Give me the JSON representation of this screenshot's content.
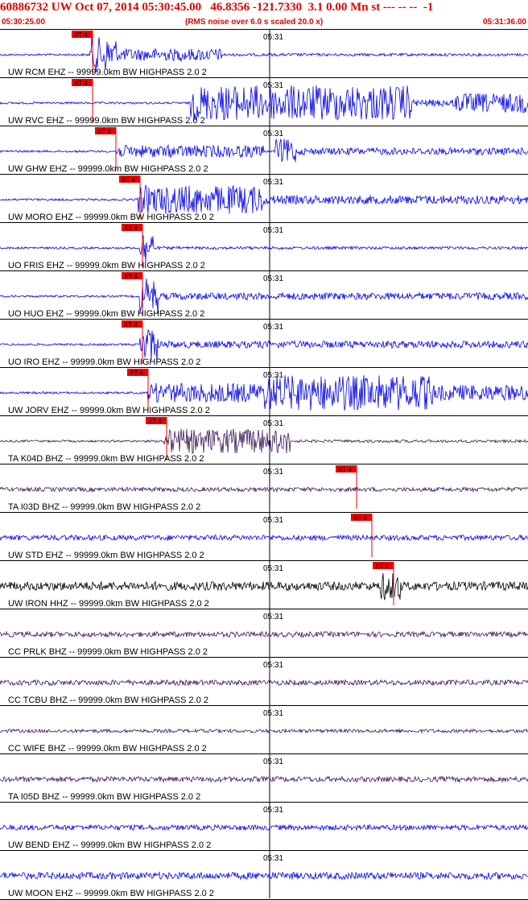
{
  "header": {
    "title": "60886732 UW Oct 07, 2014 05:30:45.00   46.8356 -121.7330  3.1 0.00 Mn st --- -- --  -1",
    "start_time": "05:30:25.00",
    "note": "(RMS noise over 6.0 s scaled 20.0 x)",
    "end_time": "05:31:36.00"
  },
  "minute_label": "05:31",
  "pick_label": "XT 4",
  "colors": {
    "blue": "#0000ee",
    "purple": "#3a1a5a",
    "black": "#000000",
    "pick": "#ee0000",
    "grid": "#000000"
  },
  "traces": [
    {
      "label": "UW RCM EHZ -- 99999.0km BW  HIGHPASS  2.0  2",
      "color": "blue",
      "pick": 0.175,
      "amp": [
        [
          0.17,
          0.22,
          1.0
        ],
        [
          0.22,
          0.42,
          0.35
        ],
        [
          0.42,
          1.0,
          0.08
        ]
      ]
    },
    {
      "label": "UW RVC EHZ -- 99999.0km BW  HIGHPASS  2.0  2",
      "color": "blue",
      "pick": 0.175,
      "amp": [
        [
          0.36,
          0.78,
          1.0
        ],
        [
          0.78,
          0.86,
          0.2
        ],
        [
          0.86,
          1.0,
          0.55
        ]
      ]
    },
    {
      "label": "UW GHW EHZ -- 99999.0km BW  HIGHPASS  2.0  2",
      "color": "blue",
      "pick": 0.22,
      "amp": [
        [
          0.22,
          0.5,
          0.35
        ],
        [
          0.52,
          0.56,
          0.7
        ],
        [
          0.56,
          1.0,
          0.2
        ]
      ]
    },
    {
      "label": "UW MORO EHZ -- 99999.0km BW  HIGHPASS  2.0  2",
      "color": "blue",
      "pick": 0.265,
      "amp": [
        [
          0.26,
          0.5,
          0.8
        ],
        [
          0.5,
          1.0,
          0.25
        ]
      ]
    },
    {
      "label": "UO FRIS EHZ -- 99999.0km BW  HIGHPASS  2.0  2",
      "color": "blue",
      "pick": 0.27,
      "amp": [
        [
          0.265,
          0.29,
          1.0
        ],
        [
          0.29,
          1.0,
          0.08
        ]
      ]
    },
    {
      "label": "UO HUO EHZ -- 99999.0km BW  HIGHPASS  2.0  2",
      "color": "blue",
      "pick": 0.27,
      "amp": [
        [
          0.265,
          0.3,
          1.0
        ],
        [
          0.3,
          1.0,
          0.2
        ]
      ]
    },
    {
      "label": "UO IRO EHZ -- 99999.0km BW  HIGHPASS  2.0  2",
      "color": "blue",
      "pick": 0.27,
      "amp": [
        [
          0.265,
          0.3,
          1.0
        ],
        [
          0.3,
          1.0,
          0.2
        ]
      ]
    },
    {
      "label": "UW JORV EHZ -- 99999.0km BW  HIGHPASS  2.0  2",
      "color": "blue",
      "pick": 0.28,
      "amp": [
        [
          0.28,
          0.5,
          0.55
        ],
        [
          0.5,
          0.82,
          1.0
        ],
        [
          0.82,
          1.0,
          0.45
        ]
      ]
    },
    {
      "label": "TA K04D BHZ -- 99999.0km BW  HIGHPASS  2.0  2",
      "color": "purple",
      "pick": 0.315,
      "amp": [
        [
          0.31,
          0.55,
          0.7
        ],
        [
          0.55,
          1.0,
          0.08
        ]
      ]
    },
    {
      "label": "TA I03D BHZ -- 99999.0km BW  HIGHPASS  2.0  2",
      "color": "purple",
      "pick": 0.675,
      "amp": [
        [
          0.0,
          1.0,
          0.12
        ]
      ]
    },
    {
      "label": "UW STD EHZ -- 99999.0km BW  HIGHPASS  2.0  2",
      "color": "blue",
      "pick": 0.705,
      "amp": [
        [
          0.0,
          1.0,
          0.15
        ]
      ]
    },
    {
      "label": "UW IRON HHZ -- 99999.0km BW  HIGHPASS  2.0  2",
      "color": "black",
      "pick": 0.745,
      "amp": [
        [
          0.0,
          0.72,
          0.25
        ],
        [
          0.72,
          0.76,
          0.8
        ],
        [
          0.76,
          1.0,
          0.25
        ]
      ]
    },
    {
      "label": "CC PRLK BHZ -- 99999.0km BW  HIGHPASS  2.0  2",
      "color": "purple",
      "pick": null,
      "amp": [
        [
          0.0,
          1.0,
          0.15
        ]
      ]
    },
    {
      "label": "CC TCBU BHZ -- 99999.0km BW  HIGHPASS  2.0  2",
      "color": "purple",
      "pick": null,
      "amp": [
        [
          0.0,
          1.0,
          0.15
        ]
      ]
    },
    {
      "label": "CC WIFE BHZ -- 99999.0km BW  HIGHPASS  2.0  2",
      "color": "purple",
      "pick": null,
      "amp": [
        [
          0.0,
          1.0,
          0.1
        ]
      ]
    },
    {
      "label": "TA I05D BHZ -- 99999.0km BW  HIGHPASS  2.0  2",
      "color": "purple",
      "pick": null,
      "amp": [
        [
          0.0,
          1.0,
          0.15
        ]
      ]
    },
    {
      "label": "UW BEND EHZ -- 99999.0km BW  HIGHPASS  2.0  2",
      "color": "blue",
      "pick": null,
      "amp": [
        [
          0.0,
          1.0,
          0.15
        ]
      ]
    },
    {
      "label": "UW MOON EHZ -- 99999.0km BW  HIGHPASS  2.0  2",
      "color": "blue",
      "pick": null,
      "amp": [
        [
          0.0,
          1.0,
          0.2
        ]
      ]
    }
  ]
}
